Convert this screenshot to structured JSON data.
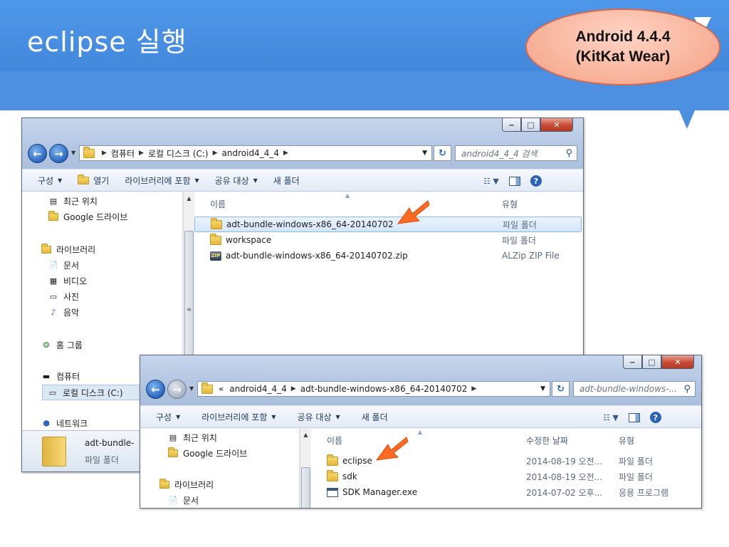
{
  "slide": {
    "title": "eclipse 실행",
    "callout_line1": "Android 4.4.4",
    "callout_line2": "(KitKat Wear)"
  },
  "colors": {
    "header": "#4a8fe0",
    "callout": "#f4a083",
    "arrow": "#ff6a21"
  },
  "window_back": {
    "address": [
      "컴퓨터",
      "로컬 디스크 (C:)",
      "android4_4_4"
    ],
    "search_placeholder": "android4_4_4 검색",
    "toolbar": {
      "organize": "구성",
      "open": "열기",
      "include_library": "라이브러리에 포함",
      "share": "공유 대상",
      "new_folder": "새 폴더"
    },
    "nav": {
      "recent": "최근 위치",
      "gdrive": "Google 드라이브",
      "libraries": "라이브러리",
      "documents": "문서",
      "videos": "비디오",
      "pictures": "사진",
      "music": "음악",
      "homegroup": "홈 그룹",
      "computer": "컴퓨터",
      "local_disk": "로컬 디스크 (C:)",
      "network": "네트워크"
    },
    "columns": {
      "name": "이름",
      "type": "유형"
    },
    "files": [
      {
        "name": "adt-bundle-windows-x86_64-20140702",
        "type": "파일 폴더",
        "icon": "folder-icon"
      },
      {
        "name": "workspace",
        "type": "파일 폴더",
        "icon": "folder-icon"
      },
      {
        "name": "adt-bundle-windows-x86_64-20140702.zip",
        "type": "ALZip ZIP File",
        "icon": "zip-icon"
      }
    ],
    "details": {
      "name": "adt-bundle-",
      "type": "파일 폴더"
    }
  },
  "window_front": {
    "address": [
      "«",
      "android4_4_4",
      "adt-bundle-windows-x86_64-20140702"
    ],
    "search_placeholder": "adt-bundle-windows-...",
    "toolbar": {
      "organize": "구성",
      "include_library": "라이브러리에 포함",
      "share": "공유 대상",
      "new_folder": "새 폴더"
    },
    "nav": {
      "recent": "최근 위치",
      "gdrive": "Google 드라이브",
      "libraries": "라이브러리",
      "documents": "문서"
    },
    "columns": {
      "name": "이름",
      "modified": "수정한 날짜",
      "type": "유형"
    },
    "files": [
      {
        "name": "eclipse",
        "modified": "2014-08-19 오전...",
        "type": "파일 폴더",
        "icon": "folder-icon"
      },
      {
        "name": "sdk",
        "modified": "2014-08-19 오전...",
        "type": "파일 폴더",
        "icon": "folder-icon"
      },
      {
        "name": "SDK Manager.exe",
        "modified": "2014-07-02 오후...",
        "type": "응용 프로그램",
        "icon": "exe-icon"
      }
    ]
  }
}
